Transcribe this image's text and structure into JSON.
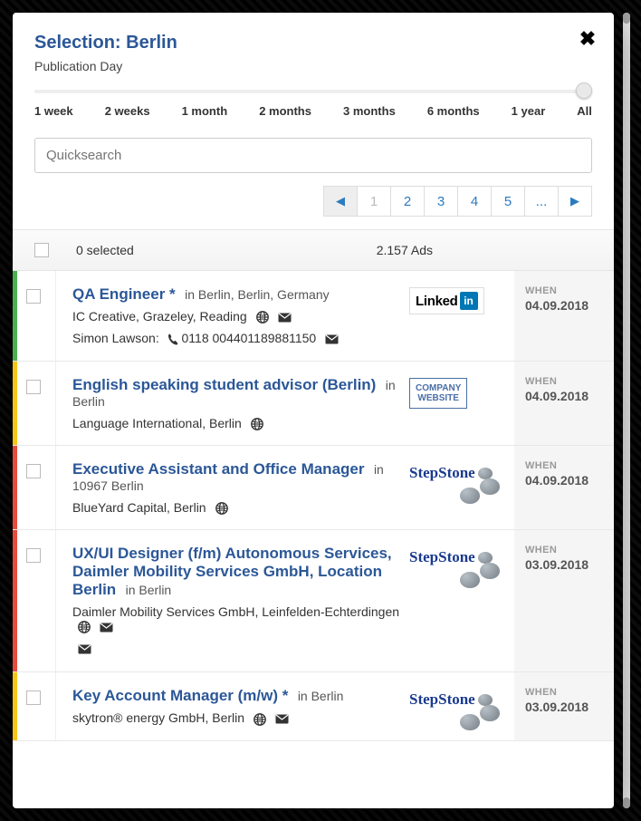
{
  "dialog": {
    "title": "Selection: Berlin",
    "subtitle": "Publication Day",
    "close_glyph": "✖"
  },
  "slider": {
    "labels": [
      "1 week",
      "2 weeks",
      "1 month",
      "2 months",
      "3 months",
      "6 months",
      "1 year",
      "All"
    ]
  },
  "search": {
    "placeholder": "Quicksearch"
  },
  "pagination": {
    "prev_glyph": "◀",
    "next_glyph": "▶",
    "pages": [
      "1",
      "2",
      "3",
      "4",
      "5",
      "..."
    ]
  },
  "list_header": {
    "selected_text": "0 selected",
    "ads_text": "2.157 Ads"
  },
  "when_label": "WHEN",
  "logos": {
    "linkedin_text": "Linked",
    "linkedin_in": "in",
    "company_website_line1": "COMPANY",
    "company_website_line2": "WEBSITE",
    "stepstone_text": "StepStone"
  },
  "rows": [
    {
      "accent": "green",
      "title": "QA Engineer *",
      "location": "in Berlin, Berlin, Germany",
      "subline": "IC Creative, Grazeley, Reading",
      "sub_icons": [
        "globe",
        "mail"
      ],
      "contact_name": "Simon Lawson:",
      "contact_number": "0118 004401189881150",
      "contact_icons": [
        "phone",
        "mail"
      ],
      "logo": "linkedin",
      "date": "04.09.2018"
    },
    {
      "accent": "yellow",
      "title": "English speaking student advisor (Berlin)",
      "location": "in Berlin",
      "subline": "Language International, Berlin",
      "sub_icons": [
        "globe"
      ],
      "logo": "company-website",
      "date": "04.09.2018"
    },
    {
      "accent": "red",
      "title": "Executive Assistant and Office Manager",
      "location": "in 10967 Berlin",
      "subline": "BlueYard Capital, Berlin",
      "sub_icons": [
        "globe"
      ],
      "logo": "stepstone",
      "date": "04.09.2018"
    },
    {
      "accent": "red",
      "title": "UX/UI Designer (f/m) Autonomous Services, Daimler Mobility Services GmbH, Location Berlin",
      "location": "in Berlin",
      "subline": "Daimler Mobility Services GmbH, Leinfelden-Echterdingen",
      "sub_icons": [
        "globe",
        "mail"
      ],
      "extra_icons": [
        "mail"
      ],
      "logo": "stepstone",
      "date": "03.09.2018"
    },
    {
      "accent": "yellow",
      "title": "Key Account Manager (m/w) *",
      "location": "in Berlin",
      "subline": "skytron® energy GmbH, Berlin",
      "sub_icons": [
        "globe",
        "mail"
      ],
      "logo": "stepstone",
      "date": "03.09.2018"
    }
  ]
}
